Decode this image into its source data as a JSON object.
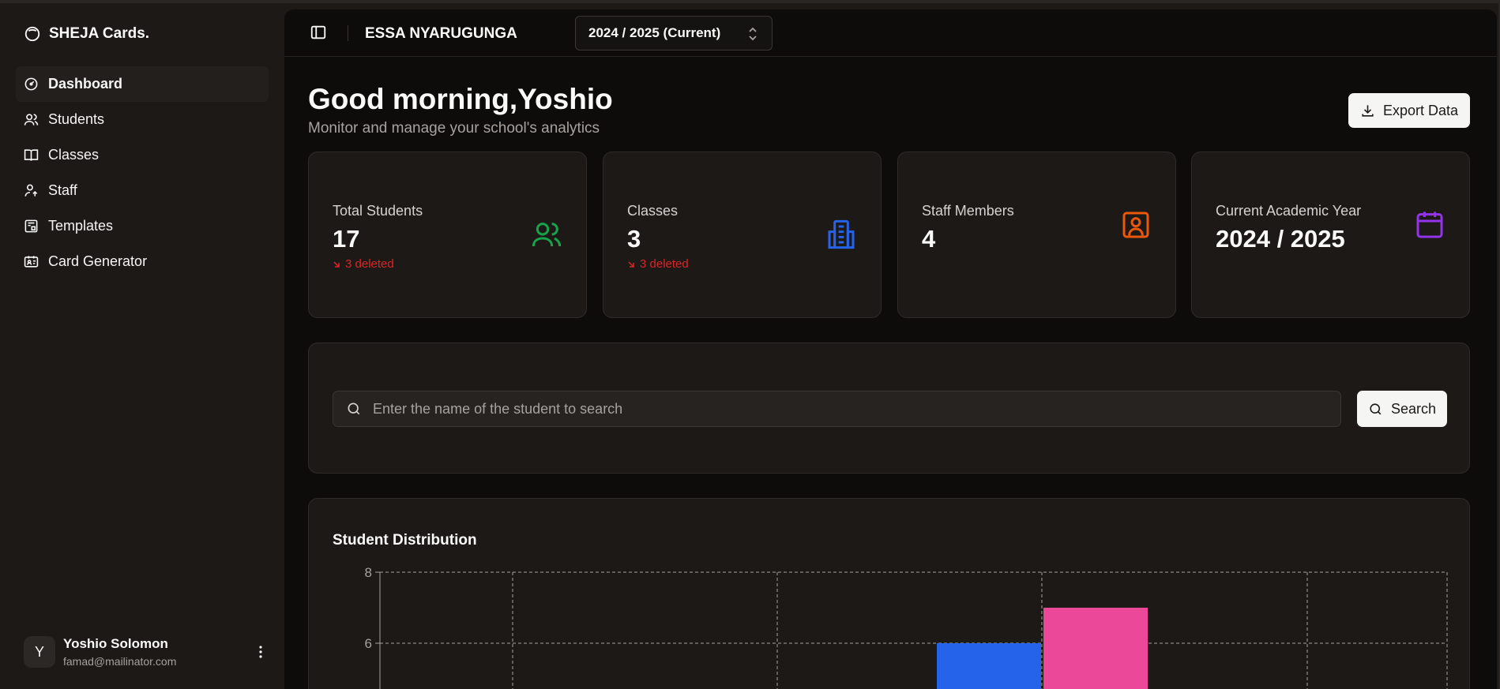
{
  "brand": {
    "name": "SHEJA Cards."
  },
  "sidebar": {
    "items": [
      {
        "label": "Dashboard",
        "icon": "gauge-icon",
        "active": true
      },
      {
        "label": "Students",
        "icon": "users-icon"
      },
      {
        "label": "Classes",
        "icon": "book-open-icon"
      },
      {
        "label": "Staff",
        "icon": "user-plus-icon"
      },
      {
        "label": "Templates",
        "icon": "template-icon"
      },
      {
        "label": "Card Generator",
        "icon": "id-card-icon"
      }
    ]
  },
  "user": {
    "initial": "Y",
    "name": "Yoshio Solomon",
    "email": "famad@mailinator.com"
  },
  "topbar": {
    "school": "ESSA NYARUGUNGA",
    "year": "2024 / 2025 (Current)"
  },
  "header": {
    "greeting": "Good morning,Yoshio",
    "subtitle": "Monitor and manage your school's analytics",
    "export_label": "Export Data"
  },
  "stats": [
    {
      "label": "Total Students",
      "value": "17",
      "delta": "3 deleted",
      "icon": "users-icon",
      "color": "#16a34a"
    },
    {
      "label": "Classes",
      "value": "3",
      "delta": "3 deleted",
      "icon": "building-icon",
      "color": "#2563eb"
    },
    {
      "label": "Staff Members",
      "value": "4",
      "delta": "",
      "icon": "contact-icon",
      "color": "#ea580c"
    },
    {
      "label": "Current Academic Year",
      "value": "2024 / 2025",
      "delta": "",
      "icon": "calendar-icon",
      "color": "#9333ea"
    }
  ],
  "search": {
    "placeholder": "Enter the name of the student to search",
    "button_label": "Search"
  },
  "chart": {
    "title": "Student Distribution"
  },
  "chart_data": {
    "type": "bar",
    "title": "Student Distribution",
    "y_ticks": [
      6,
      8
    ],
    "ylim_visible": [
      6,
      8
    ],
    "grid": true,
    "series": [
      {
        "color": "#2563eb",
        "value": 6
      },
      {
        "color": "#ec4899",
        "value": 7
      }
    ]
  }
}
